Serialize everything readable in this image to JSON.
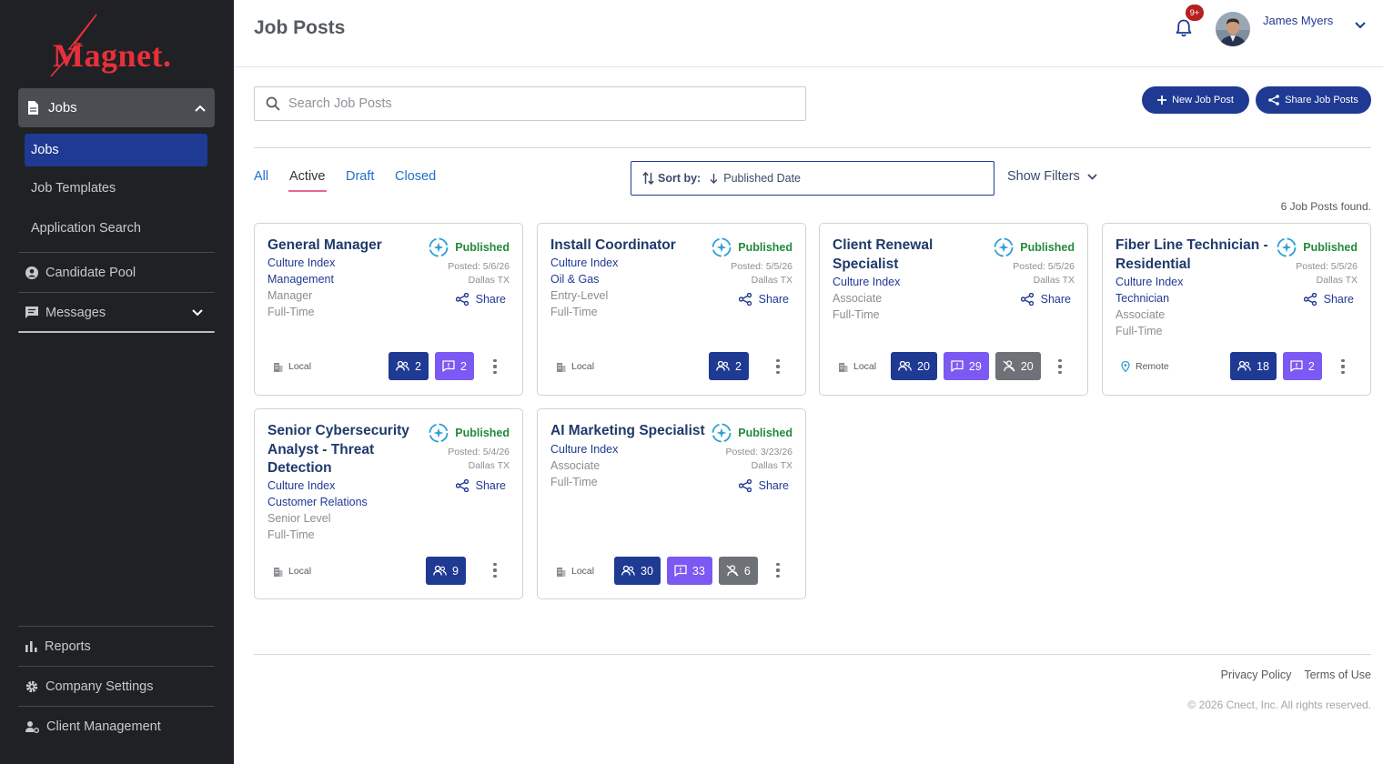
{
  "brand": {
    "name": "Magnet.",
    "accent": "#e8303a"
  },
  "sidebar": {
    "jobs_header": "Jobs",
    "jobs_sub": [
      "Jobs",
      "Job Templates",
      "Application Search"
    ],
    "items": [
      "Candidate Pool",
      "Messages"
    ],
    "bottom_items": [
      "Reports",
      "Company Settings",
      "Client Management"
    ]
  },
  "header": {
    "title": "Job Posts",
    "notification_badge": "9+",
    "user_name": "James Myers"
  },
  "search": {
    "placeholder": "Search Job Posts"
  },
  "actions": {
    "new_post": "New Job Post",
    "share_posts": "Share Job Posts"
  },
  "tabs": [
    "All",
    "Active",
    "Draft",
    "Closed"
  ],
  "active_tab": "Active",
  "sort": {
    "label": "Sort by:",
    "value": "Published Date"
  },
  "filters_label": "Show Filters",
  "found_text": "6 Job Posts found.",
  "cards": [
    {
      "title": "General Manager",
      "status": "Published",
      "posted": "Posted: 5/6/26",
      "location": "Dallas TX",
      "share": "Share",
      "lines": [
        "Culture Index",
        "Management",
        "Manager",
        "Full-Time"
      ],
      "work_type": "Local",
      "counts": {
        "applicants": "2",
        "messages": "2"
      }
    },
    {
      "title": "Install Coordinator",
      "status": "Published",
      "posted": "Posted: 5/5/26",
      "location": "Dallas TX",
      "share": "Share",
      "lines": [
        "Culture Index",
        "Oil & Gas",
        "Entry-Level",
        "Full-Time"
      ],
      "work_type": "Local",
      "counts": {
        "applicants": "2"
      }
    },
    {
      "title": "Client Renewal Specialist",
      "status": "Published",
      "posted": "Posted: 5/5/26",
      "location": "Dallas TX",
      "share": "Share",
      "lines": [
        "Culture Index",
        "Associate",
        "Full-Time"
      ],
      "work_type": "Local",
      "counts": {
        "applicants": "20",
        "messages": "29",
        "rejected": "20"
      }
    },
    {
      "title": "Fiber Line Technician - Residential",
      "status": "Published",
      "posted": "Posted: 5/5/26",
      "location": "Dallas TX",
      "share": "Share",
      "lines": [
        "Culture Index",
        "Technician",
        "Associate",
        "Full-Time"
      ],
      "work_type": "Remote",
      "counts": {
        "applicants": "18",
        "messages": "2"
      }
    },
    {
      "title": "Senior Cybersecurity Analyst - Threat Detection",
      "status": "Published",
      "posted": "Posted: 5/4/26",
      "location": "Dallas TX",
      "share": "Share",
      "lines": [
        "Culture Index",
        "Customer Relations",
        "Senior Level",
        "Full-Time"
      ],
      "work_type": "Local",
      "counts": {
        "applicants": "9"
      }
    },
    {
      "title": "AI Marketing Specialist",
      "status": "Published",
      "posted": "Posted: 3/23/26",
      "location": "Dallas TX",
      "share": "Share",
      "lines": [
        "Culture Index",
        "Associate",
        "Full-Time"
      ],
      "work_type": "Local",
      "counts": {
        "applicants": "30",
        "messages": "33",
        "rejected": "6"
      }
    }
  ],
  "footer": {
    "privacy": "Privacy Policy",
    "terms": "Terms of Use",
    "copyright": "© 2026 Cnect, Inc. All rights reserved."
  },
  "colors": {
    "navy": "#1f3a93",
    "purple": "#7b59f2",
    "published_green": "#218a3a",
    "sidebar_bg": "#1f2124"
  }
}
